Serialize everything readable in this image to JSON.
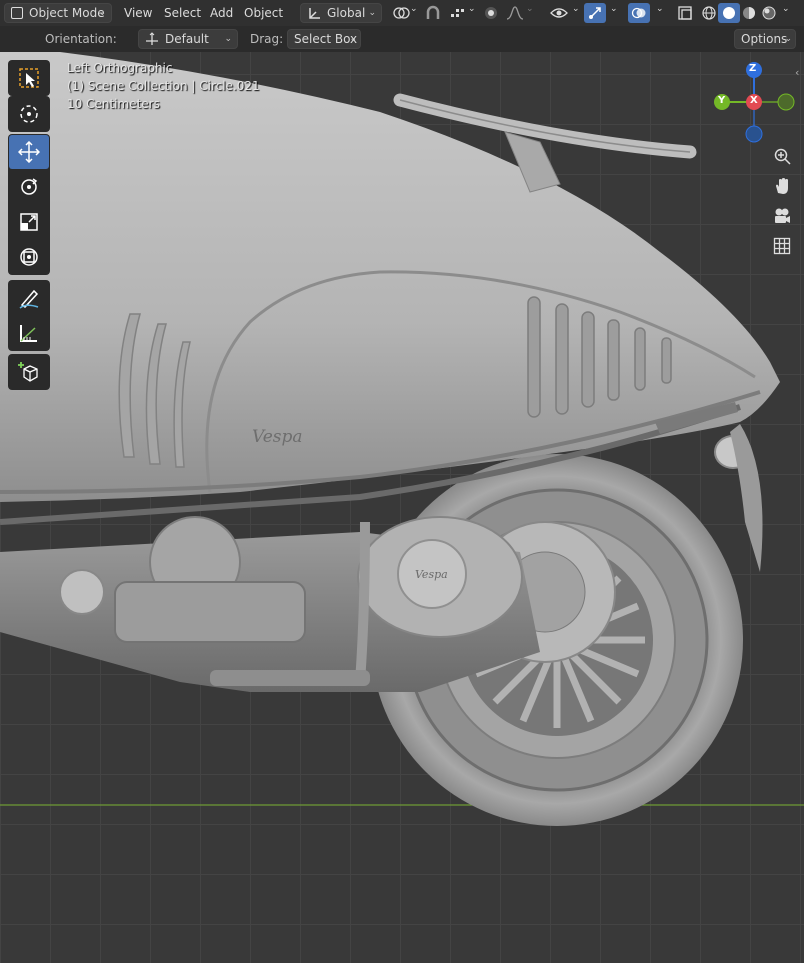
{
  "header": {
    "mode_label": "Object Mode",
    "menus": [
      "View",
      "Select",
      "Add",
      "Object"
    ],
    "transform_orientation": "Global"
  },
  "tool_settings": {
    "orientation_label": "Orientation:",
    "orientation_value": "Default",
    "drag_label": "Drag:",
    "drag_value": "Select Box",
    "options_label": "Options"
  },
  "viewport": {
    "view_name": "Left Orthographic",
    "collection": "(1) Scene Collection | Circle.021",
    "scale": "10 Centimeters"
  },
  "gizmo": {
    "z_label": "Z",
    "y_label": "Y",
    "x_label": "X",
    "z_color": "#2f6fdd",
    "y_color": "#74b827",
    "x_color": "#e24a52"
  },
  "colors": {
    "accent": "#4772b3",
    "header": "#303030",
    "viewport": "#393939",
    "grid": "#444444",
    "horizon": "#6e9b35"
  },
  "toolbar": [
    "select-box",
    "cursor",
    "move",
    "rotate",
    "scale",
    "transform",
    "annotate",
    "measure",
    "add-cube"
  ],
  "navigation": [
    "zoom",
    "pan",
    "camera",
    "grid"
  ]
}
